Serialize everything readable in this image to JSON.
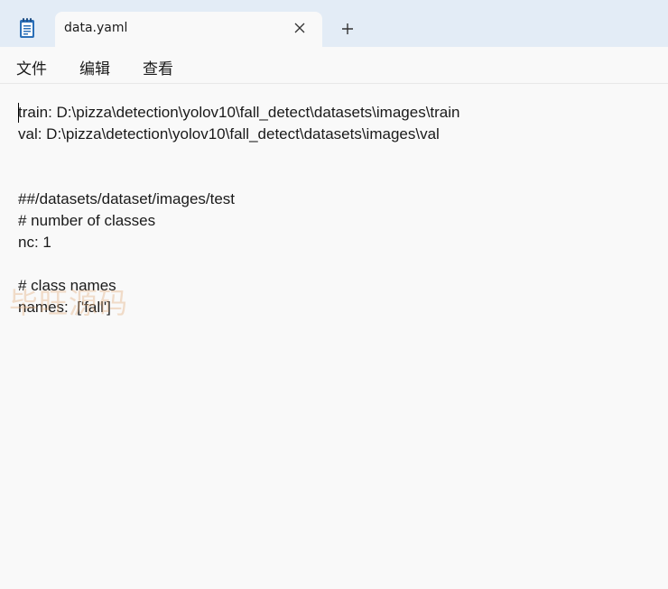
{
  "window": {
    "tab_title": "data.yaml",
    "new_tab_symbol": "+"
  },
  "icons": {
    "app": "notepad-icon",
    "close": "close-icon",
    "add": "plus-icon"
  },
  "menu": {
    "file": "文件",
    "edit": "编辑",
    "view": "查看"
  },
  "editor": {
    "content": "train: D:\\pizza\\detection\\yolov10\\fall_detect\\datasets\\images\\train\nval: D:\\pizza\\detection\\yolov10\\fall_detect\\datasets\\images\\val\n\n\n##/datasets/dataset/images/test\n# number of classes\nnc: 1\n\n# class names\nnames:  ['fall']"
  },
  "watermark": {
    "text": "毕旺源码"
  },
  "colors": {
    "titlebar": "#e3ecf6",
    "background": "#f9f9f9",
    "text": "#1a1a1a",
    "app_icon": "#1f5fa8"
  }
}
